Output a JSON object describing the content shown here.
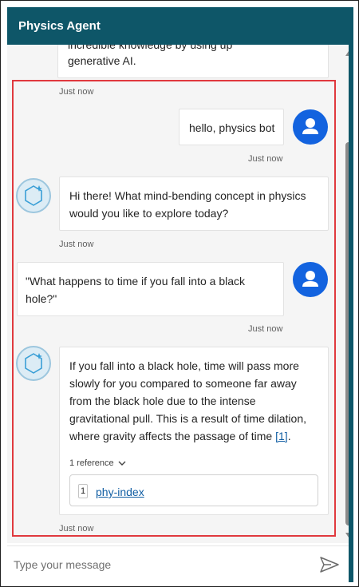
{
  "header": {
    "title": "Physics Agent"
  },
  "messages": {
    "prev_bot": {
      "line1": "incredible knowledge by using up",
      "line2": "generative AI.",
      "time": "Just now"
    },
    "user1": {
      "text": "hello, physics bot",
      "time": "Just now"
    },
    "bot1": {
      "line1": "Hi there! What mind-bending concept in physics",
      "line2": "would you like to explore today?",
      "time": "Just now"
    },
    "user2": {
      "line1": "\"What happens to time if you fall into a black",
      "line2": "hole?\"",
      "time": "Just now"
    },
    "bot2": {
      "l1": "If you fall into a black hole, time will pass more",
      "l2": "slowly for you compared to someone far away",
      "l3": "from the black hole due to the intense",
      "l4": "gravitational pull. This is a result of time dilation,",
      "l5": "where gravity affects the passage of time",
      "citation": "[1]",
      "period": ".",
      "references_label": "1 reference",
      "reference": {
        "number": "1",
        "title": "phy-index"
      },
      "time": "Just now"
    }
  },
  "composer": {
    "placeholder": "Type your message"
  },
  "icons": {
    "bot_avatar": "sparkle-hexagon-icon",
    "user_avatar": "person-icon",
    "send": "send-icon",
    "expand": "chevron-down-icon"
  },
  "colors": {
    "header_bg": "#0e5668",
    "user_avatar": "#1363df",
    "link": "#115ea3",
    "highlight_border": "#e0393e"
  }
}
